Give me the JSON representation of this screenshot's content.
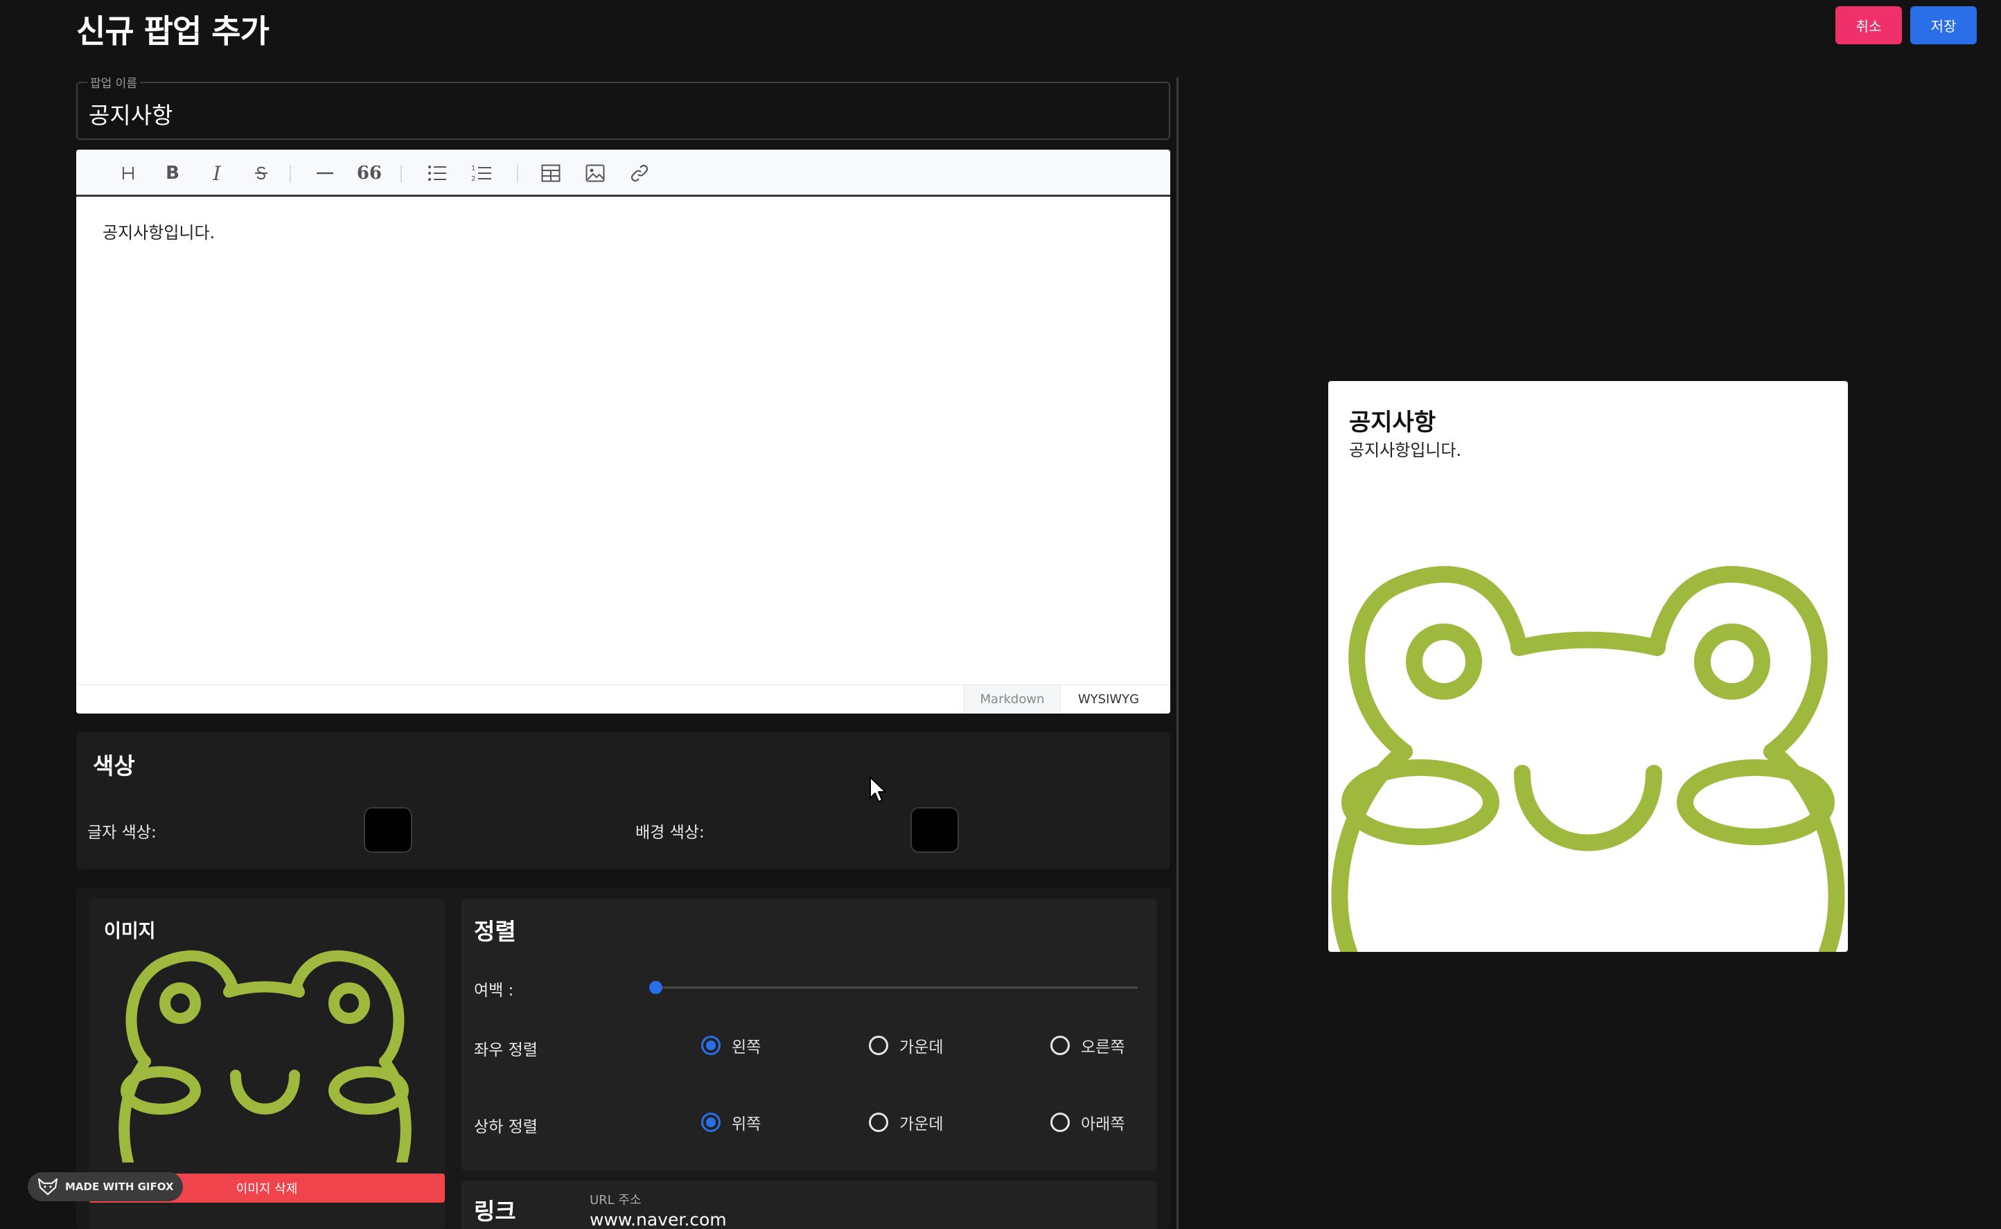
{
  "header": {
    "title": "신규 팝업 추가",
    "cancel_label": "취소",
    "save_label": "저장"
  },
  "name_field": {
    "legend": "팝업 이름",
    "value": "공지사항"
  },
  "editor": {
    "toolbar": [
      "heading-icon",
      "bold-icon",
      "italic-icon",
      "strikethrough-icon",
      "hr-icon",
      "quote-icon",
      "bullet-list-icon",
      "ordered-list-icon",
      "table-icon",
      "image-icon",
      "link-icon"
    ],
    "content": "공지사항입니다.",
    "mode_tabs": {
      "markdown": "Markdown",
      "wysiwyg": "WYSIWYG"
    },
    "active_mode": "WYSIWYG"
  },
  "colors": {
    "title": "색상",
    "text_color_label": "글자 색상:",
    "bg_color_label": "배경 색상:",
    "text_color": "#000000",
    "bg_color": "#000000"
  },
  "image": {
    "title": "이미지",
    "delete_label": "이미지 삭제",
    "frog_color": "#9fb83e"
  },
  "alignment": {
    "title": "정렬",
    "margin_label": "여백 :",
    "margin_value": 0,
    "horizontal": {
      "label": "좌우 정렬",
      "options": [
        "왼쪽",
        "가운데",
        "오른쪽"
      ],
      "selected": "왼쪽"
    },
    "vertical": {
      "label": "상하 정렬",
      "options": [
        "위쪽",
        "가운데",
        "아래쪽"
      ],
      "selected": "위쪽"
    }
  },
  "link": {
    "title": "링크",
    "url_label": "URL 주소",
    "url_value": "www.naver.com"
  },
  "preview": {
    "title": "공지사항",
    "body": "공지사항입니다."
  },
  "watermark": {
    "text": "MADE WITH GIFOX"
  },
  "accent": {
    "primary": "#2b6fe8",
    "danger": "#f0306a"
  }
}
